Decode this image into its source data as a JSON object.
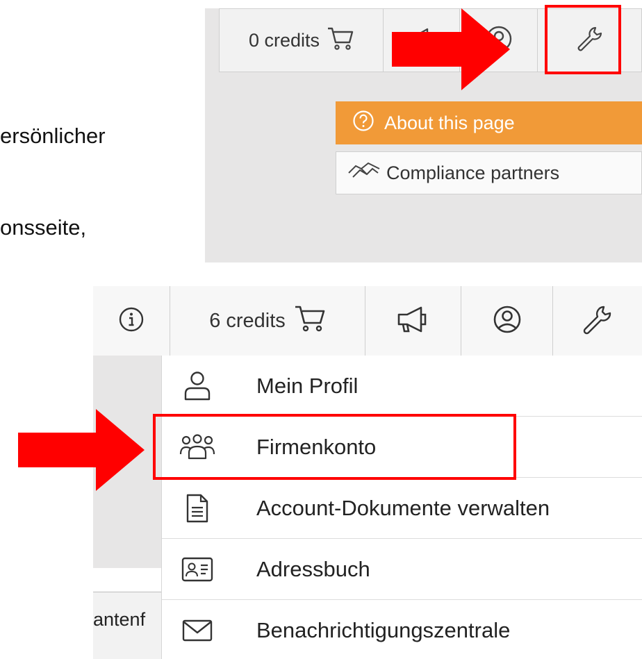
{
  "document_text": {
    "line1": "ersönlicher",
    "line2": "onsseite,"
  },
  "top_screenshot": {
    "credits_label": "0 credits",
    "menu": {
      "about_label": "About this page",
      "compliance_label": "Compliance partners"
    },
    "icons": [
      "cart-icon",
      "user-circle-icon",
      "wrench-icon",
      "question-circle-icon",
      "handshake-icon"
    ]
  },
  "bottom_screenshot": {
    "credits_label": "6 credits",
    "side_text": "antenf",
    "menu": {
      "items": [
        {
          "label": "Mein Profil",
          "icon": "user-icon"
        },
        {
          "label": "Firmenkonto",
          "icon": "users-group-icon"
        },
        {
          "label": "Account-Dokumente verwalten",
          "icon": "document-icon"
        },
        {
          "label": "Adressbuch",
          "icon": "address-card-icon"
        },
        {
          "label": "Benachrichtigungszentrale",
          "icon": "envelope-icon"
        }
      ]
    },
    "icons": [
      "info-icon",
      "cart-icon",
      "megaphone-icon",
      "user-circle-icon",
      "wrench-icon"
    ]
  },
  "colors": {
    "highlight_red": "#ff0000",
    "about_orange": "#f19a38",
    "panel_grey": "#e7e6e6"
  }
}
